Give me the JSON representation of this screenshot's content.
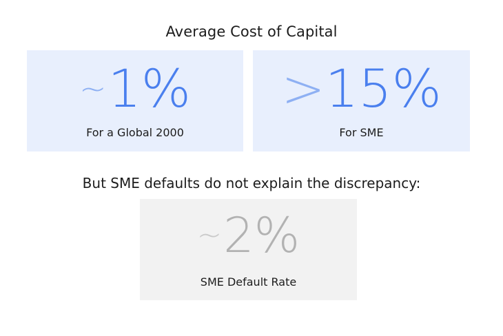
{
  "title": "Average Cost of Capital",
  "cards": [
    {
      "prefix": "~",
      "value": "1%",
      "label": "For a Global 2000",
      "color": "#4a7fee",
      "background": "#e8effd"
    },
    {
      "prefix": ">",
      "value": "15%",
      "label": "For SME",
      "color": "#4a7fee",
      "background": "#e8effd"
    }
  ],
  "subtitle": "But SME defaults do not explain the discrepancy:",
  "bottom_card": {
    "prefix": "~",
    "value": "2%",
    "label": "SME Default Rate",
    "color": "#b2b2b2",
    "background": "#f2f2f2"
  }
}
